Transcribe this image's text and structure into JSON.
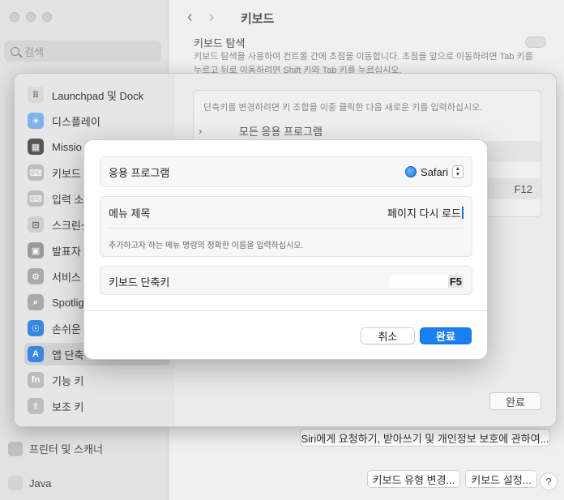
{
  "main": {
    "title": "키보드",
    "nav_heading": "키보드 탐색",
    "nav_desc_line1": "키보드 탐색을 사용하여 컨트롤 간에 초점을 이동합니다. 초점을 앞으로 이동하려면 Tab 키를",
    "nav_desc_line2": "누르고 뒤로 이동하려면 Shift 키와 Tab 키를 누르십시오.",
    "siri_button": "Siri에게 요청하기, 받아쓰기 및 개인정보 보호에 관하여...",
    "keyboard_type_button": "키보드 유형 변경...",
    "keyboard_setup_button": "키보드 설정...",
    "help": "?"
  },
  "sidebar": {
    "search_placeholder": "검색",
    "bottom_items": [
      {
        "label": "프린터 및 스캐너"
      },
      {
        "label": "Java"
      }
    ]
  },
  "sheet": {
    "hint": "단축키를 변경하려면 키 조합을 이중 클릭한 다음 새로운 키를 입력하십시오.",
    "items": [
      {
        "label": "Launchpad 및 Dock"
      },
      {
        "label": "디스플레이"
      },
      {
        "label": "Missio"
      },
      {
        "label": "키보드"
      },
      {
        "label": "입력 소"
      },
      {
        "label": "스크린샷"
      },
      {
        "label": "발표자"
      },
      {
        "label": "서비스"
      },
      {
        "label": "Spotlig"
      },
      {
        "label": "손쉬운"
      },
      {
        "label": "앱 단축"
      },
      {
        "label": "기능 키"
      },
      {
        "label": "보조 키"
      }
    ],
    "all_apps": "모든 응용 프로그램",
    "shortcut_value": "F12",
    "done": "완료"
  },
  "dialog": {
    "app_label": "응용 프로그램",
    "app_value": "Safari",
    "menu_label": "메뉴 제목",
    "menu_value": "페이지 다시 로드",
    "menu_hint": "추가하고자 하는 메뉴 명령의 정확한 이름을 입력하십시오.",
    "shortcut_label": "키보드 단축키",
    "shortcut_value": "F5",
    "cancel": "취소",
    "ok": "완료"
  },
  "colors": {
    "accent": "#1a7ff2"
  }
}
